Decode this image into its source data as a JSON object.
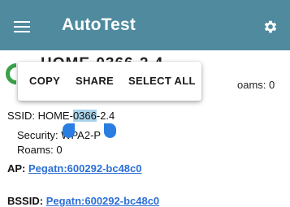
{
  "app": {
    "title": "AutoTest"
  },
  "icons": {
    "menu": "hamburger-menu-icon",
    "settings": "gear-icon",
    "status": "status-ring-icon"
  },
  "colors": {
    "appbar": "#4f8a9e",
    "selection_handle": "#2a7de1",
    "selection_highlight": "#a9d3ea",
    "link": "#2b6fd6",
    "status": "#3aa14a"
  },
  "context_menu": {
    "items": [
      "COPY",
      "SHARE",
      "SELECT ALL"
    ]
  },
  "network": {
    "header_partial": "HOME-0366-2.4",
    "roams_header": "oams: 0",
    "ssid_label": "SSID:",
    "ssid_prefix": "HOME-",
    "ssid_selected": "0366",
    "ssid_suffix": "-2.4",
    "security_label": "Security:",
    "security_value": "WPA2-P",
    "roams_label": "Roams:",
    "roams_value": "0",
    "ap_label": "AP:",
    "ap_value": "Pegatn:600292-bc48c0",
    "bssid_label": "BSSID:",
    "bssid_value": "Pegatn:600292-bc48c0"
  }
}
